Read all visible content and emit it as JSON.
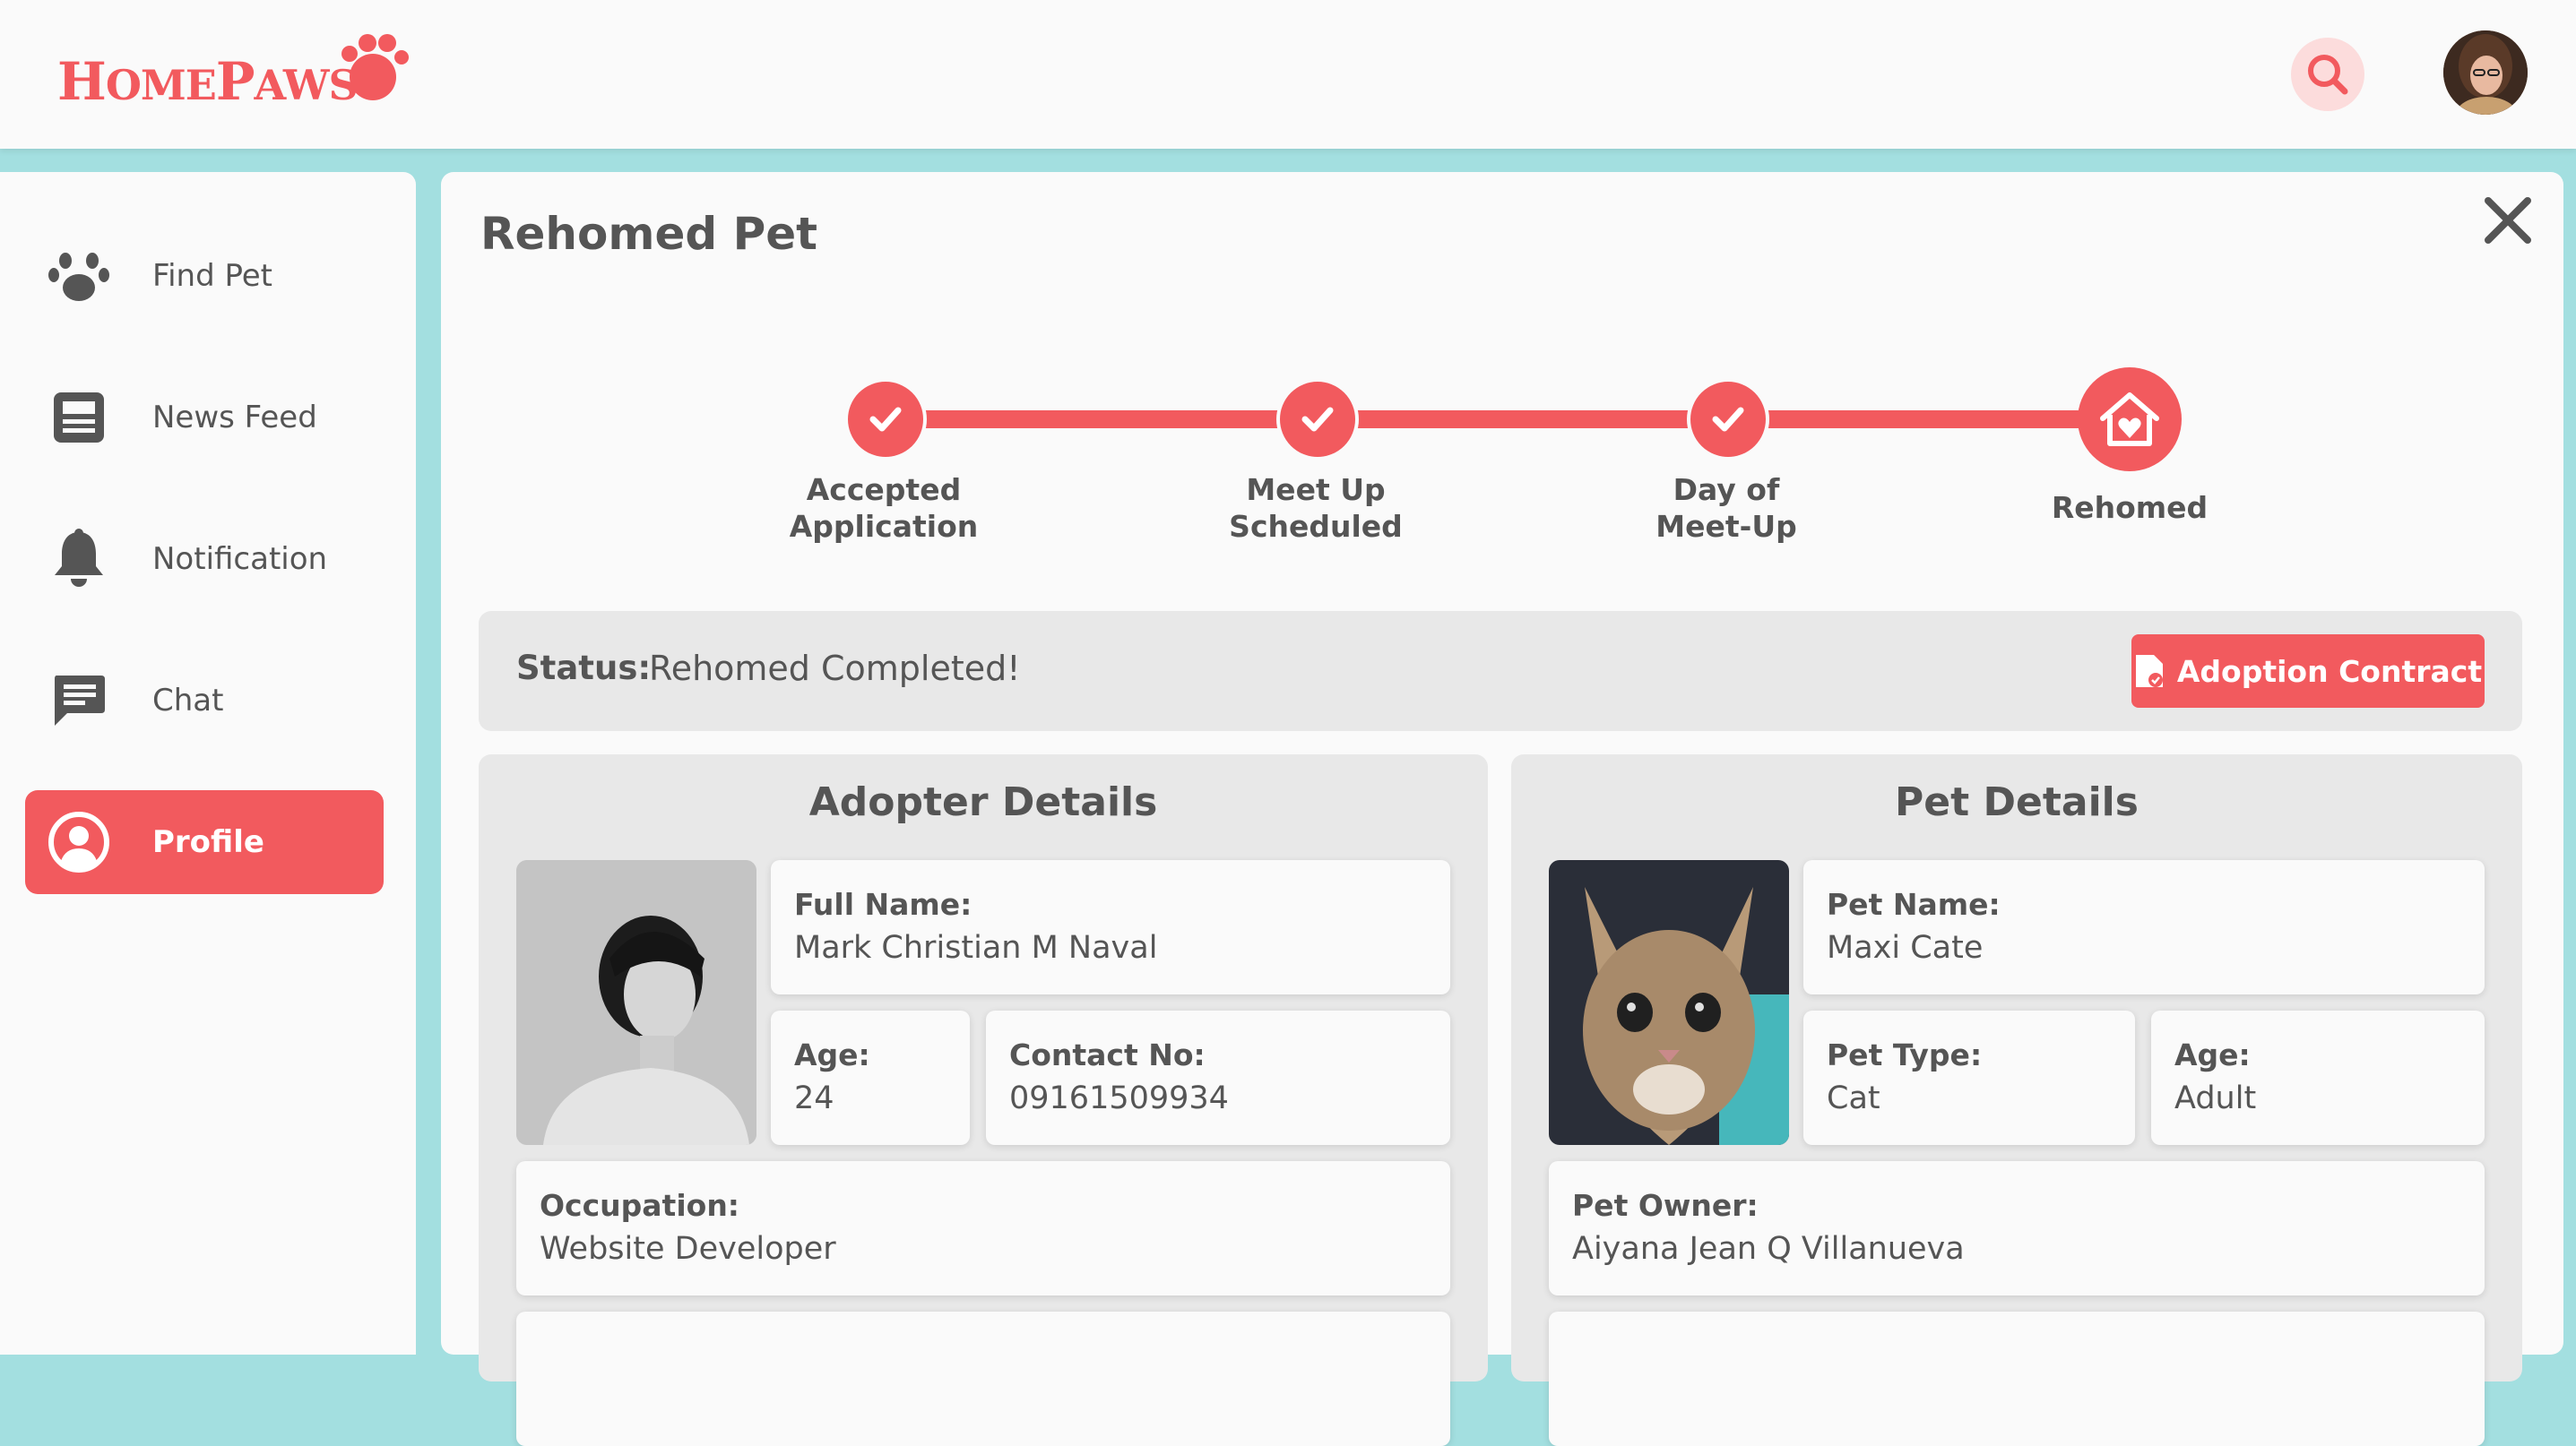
{
  "header": {
    "brand": {
      "home": "Home",
      "paws": "Paws",
      "home_initial": "H",
      "home_rest": "OME",
      "paws_initial": "P",
      "paws_rest": "AWS"
    },
    "search_icon": "search-icon",
    "avatar_icon": "user-avatar"
  },
  "sidebar": {
    "items": [
      {
        "label": "Find Pet",
        "icon": "paw-icon",
        "active": false
      },
      {
        "label": "News Feed",
        "icon": "newspaper-icon",
        "active": false
      },
      {
        "label": "Notification",
        "icon": "bell-icon",
        "active": false
      },
      {
        "label": "Chat",
        "icon": "chat-icon",
        "active": false
      },
      {
        "label": "Profile",
        "icon": "user-circle-icon",
        "active": true
      }
    ]
  },
  "main": {
    "title": "Rehomed Pet",
    "steps": [
      {
        "label": "Accepted\nApplication",
        "done": true
      },
      {
        "label": "Meet Up\nScheduled",
        "done": true
      },
      {
        "label": "Day of\nMeet-Up",
        "done": true
      },
      {
        "label": "Rehomed",
        "current": true
      }
    ],
    "status": {
      "key": "Status:",
      "value": "Rehomed Completed!",
      "contract_button": "Adoption Contract"
    },
    "adopter": {
      "title": "Adopter Details",
      "full_name_label": "Full Name:",
      "full_name": "Mark Christian M Naval",
      "age_label": "Age:",
      "age": "24",
      "contact_label": "Contact No:",
      "contact": "09161509934",
      "occupation_label": "Occupation:",
      "occupation": "Website Developer"
    },
    "pet": {
      "title": "Pet Details",
      "name_label": "Pet Name:",
      "name": "Maxi Cate",
      "type_label": "Pet Type:",
      "type": "Cat",
      "age_label": "Age:",
      "age": "Adult",
      "owner_label": "Pet Owner:",
      "owner": "Aiyana Jean Q Villanueva"
    }
  },
  "colors": {
    "accent": "#f25a5e",
    "background": "#a3dfe0",
    "panel": "#e8e8e8",
    "surface": "#fafafa",
    "text": "#555555"
  }
}
